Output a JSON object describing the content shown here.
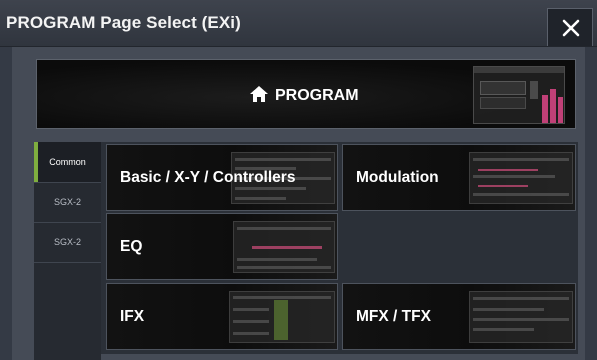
{
  "window": {
    "title": "PROGRAM Page Select (EXi)",
    "close_label": "✕"
  },
  "banner": {
    "label": "PROGRAM",
    "icon": "home-icon"
  },
  "tabs": [
    {
      "label": "Common",
      "active": true
    },
    {
      "label": "SGX-2",
      "active": false
    },
    {
      "label": "SGX-2",
      "active": false
    }
  ],
  "tiles": {
    "basic": "Basic / X-Y / Controllers",
    "modulation": "Modulation",
    "eq": "EQ",
    "ifx": "IFX",
    "mfx": "MFX / TFX"
  },
  "colors": {
    "accent_green": "#7fae3f",
    "highlight_pink": "#e04a8a"
  }
}
